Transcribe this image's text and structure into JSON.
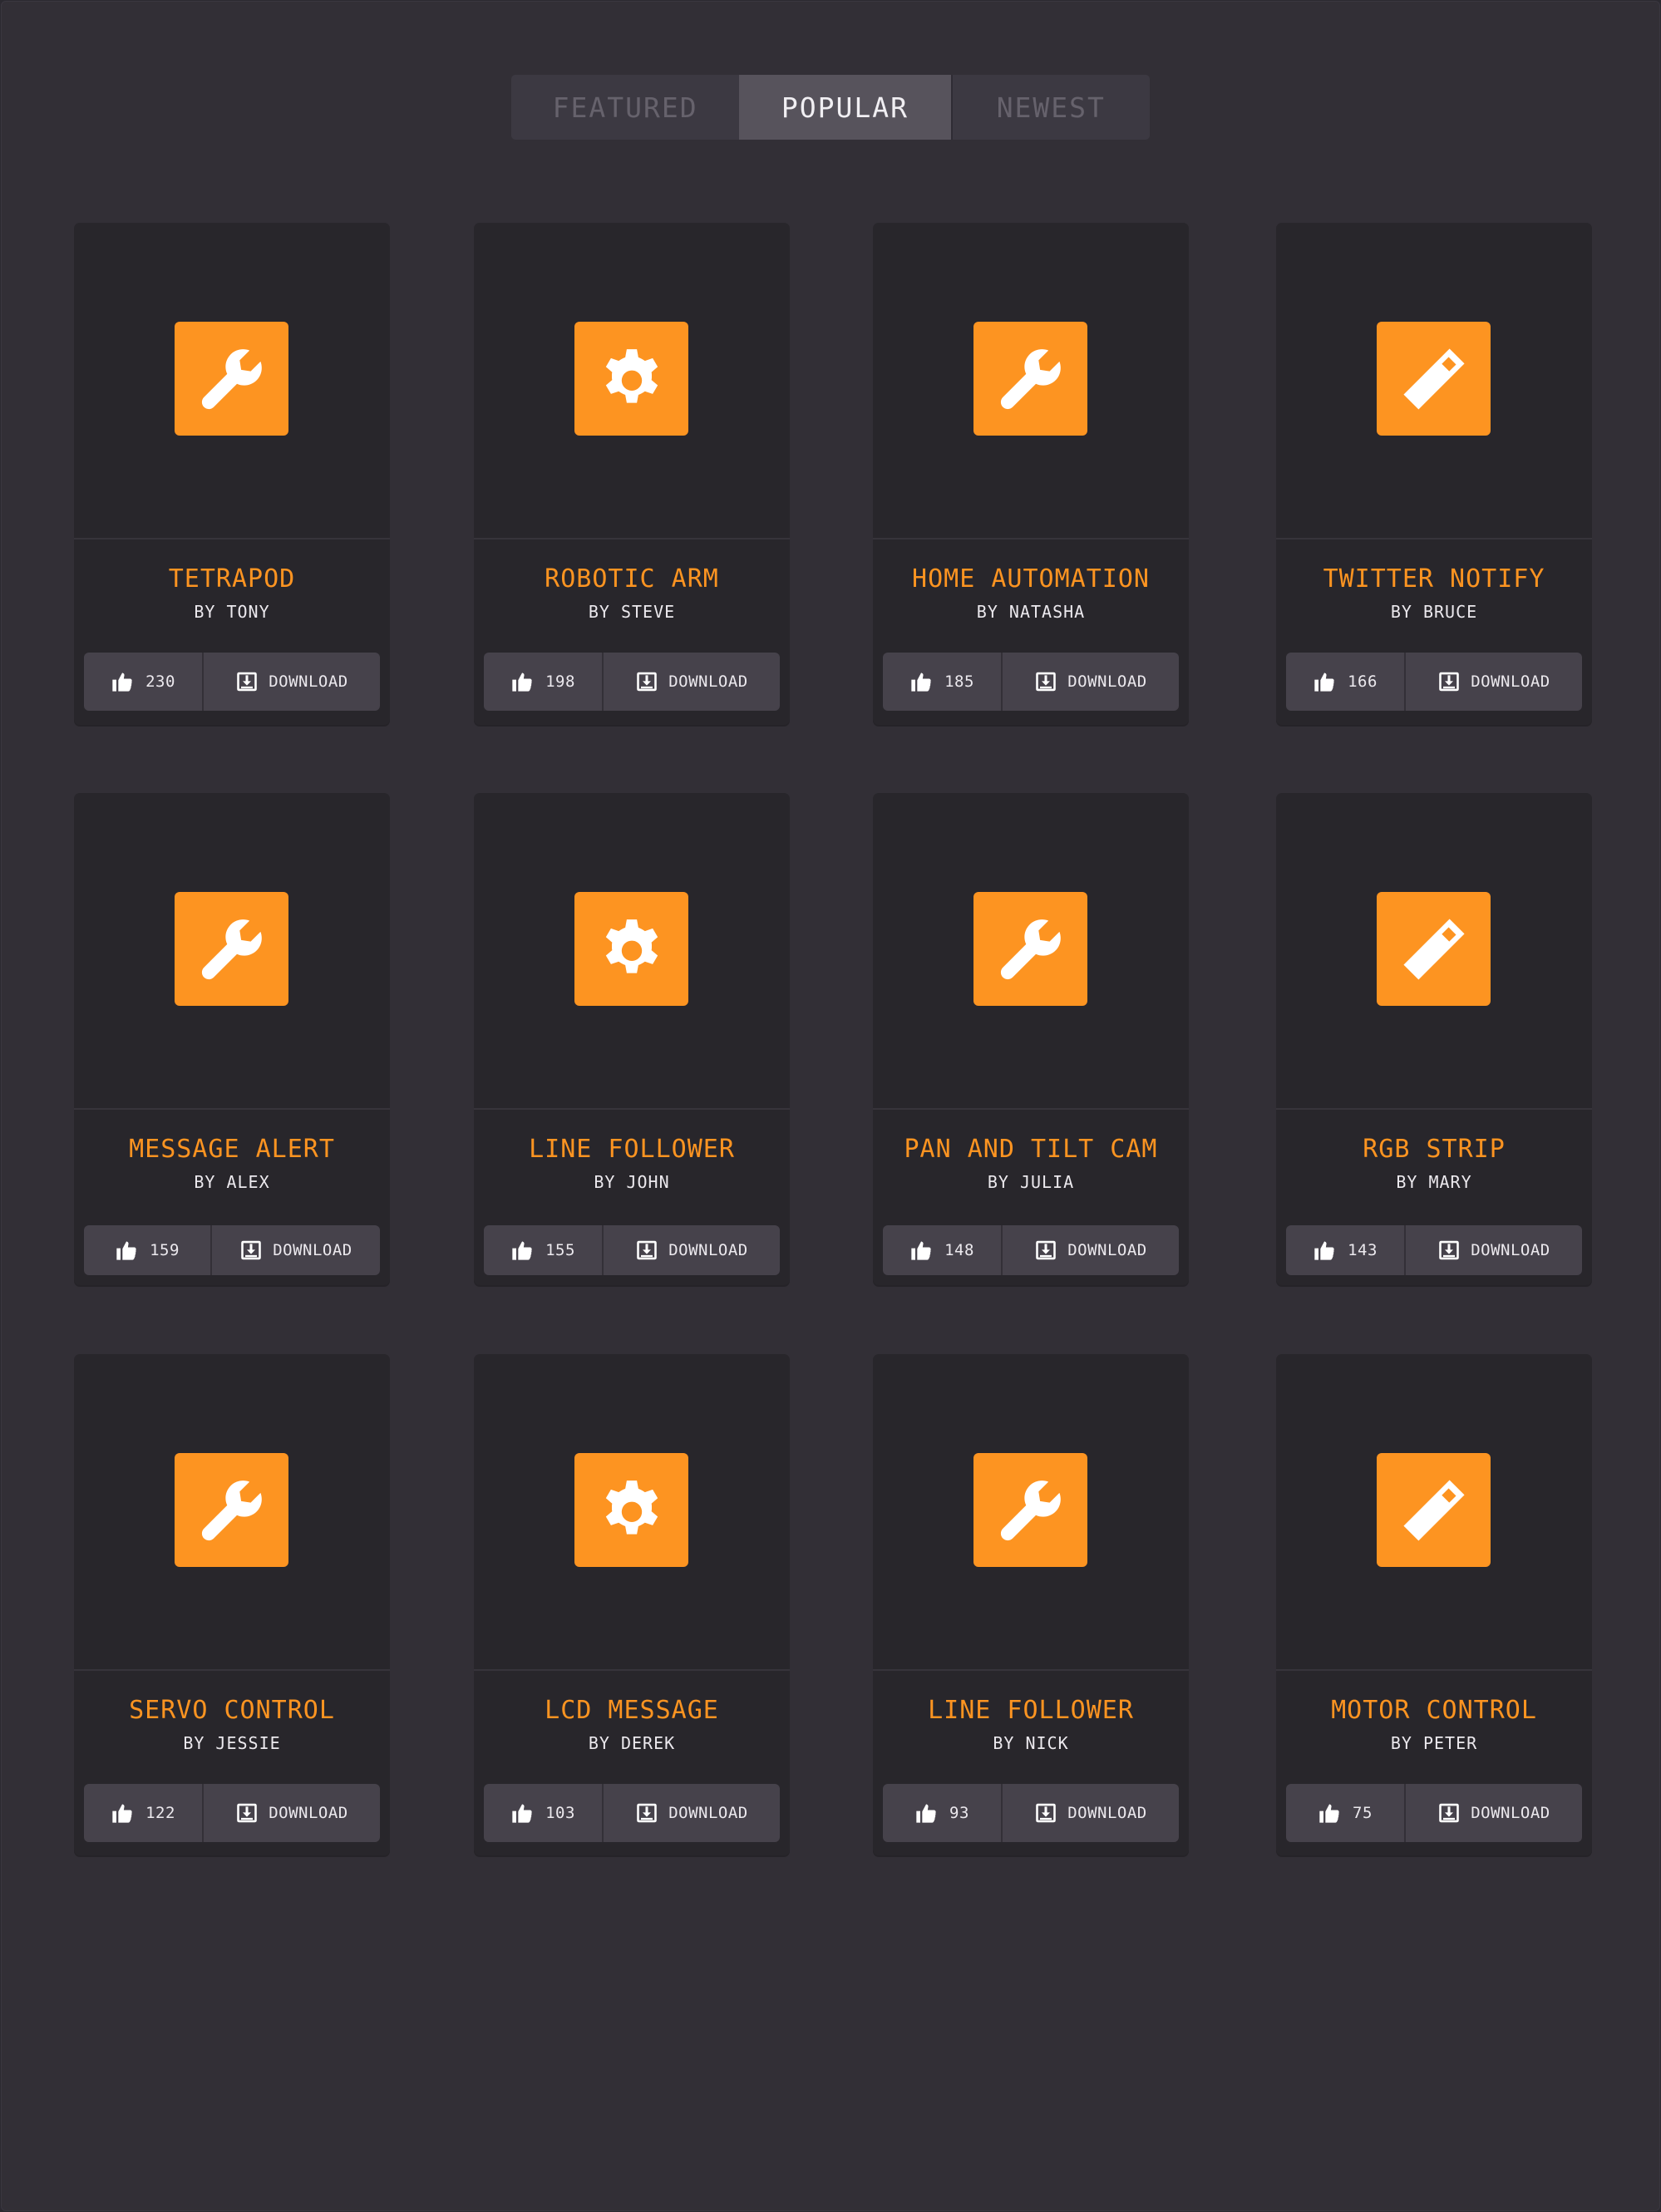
{
  "tabs": [
    {
      "label": "FEATURED",
      "active": false
    },
    {
      "label": "POPULAR",
      "active": true
    },
    {
      "label": "NEWEST",
      "active": false
    }
  ],
  "colors": {
    "accent": "#fd9421",
    "background": "#322f36",
    "card": "#28262b",
    "button": "#46424b",
    "text": "#ece9ee"
  },
  "download_label": "DOWNLOAD",
  "projects": [
    {
      "title": "TETRAPOD",
      "author": "BY TONY",
      "likes": "230",
      "icon": "wrench-icon"
    },
    {
      "title": "ROBOTIC ARM",
      "author": "BY STEVE",
      "likes": "198",
      "icon": "gear-icon"
    },
    {
      "title": "HOME AUTOMATION",
      "author": "BY NATASHA",
      "likes": "185",
      "icon": "wrench-icon"
    },
    {
      "title": "TWITTER NOTIFY",
      "author": "BY BRUCE",
      "likes": "166",
      "icon": "ruler-icon"
    },
    {
      "title": "MESSAGE ALERT",
      "author": "BY ALEX",
      "likes": "159",
      "icon": "wrench-icon"
    },
    {
      "title": "LINE FOLLOWER",
      "author": "BY JOHN",
      "likes": "155",
      "icon": "gear-icon"
    },
    {
      "title": "PAN AND TILT CAM",
      "author": "BY JULIA",
      "likes": "148",
      "icon": "wrench-icon"
    },
    {
      "title": "RGB STRIP",
      "author": "BY MARY",
      "likes": "143",
      "icon": "ruler-icon"
    },
    {
      "title": "SERVO CONTROL",
      "author": "BY JESSIE",
      "likes": "122",
      "icon": "wrench-icon"
    },
    {
      "title": "LCD MESSAGE",
      "author": "BY DEREK",
      "likes": "103",
      "icon": "gear-icon"
    },
    {
      "title": "LINE FOLLOWER",
      "author": "BY NICK",
      "likes": "93",
      "icon": "wrench-icon"
    },
    {
      "title": "MOTOR CONTROL",
      "author": "BY PETER",
      "likes": "75",
      "icon": "ruler-icon"
    }
  ]
}
